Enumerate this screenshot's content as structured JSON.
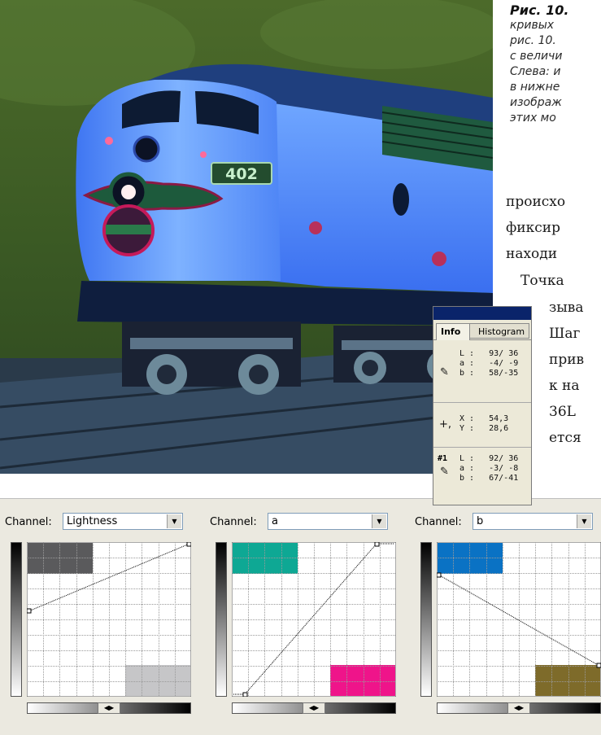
{
  "caption": {
    "title": "Рис. 10.",
    "lines": [
      "кривых",
      "рис. 10.",
      "с величи",
      "Слева: и",
      "в нижне",
      "изображ",
      "этих мо"
    ]
  },
  "body_text": {
    "lines": [
      "происхо",
      "фиксир",
      "находи",
      "Точка",
      "зыва",
      "Шаг",
      "прив",
      "к на",
      "36L",
      "ется"
    ]
  },
  "photo": {
    "number_plate": "402"
  },
  "info_panel": {
    "tabs": [
      "Info",
      "Histogram"
    ],
    "lab_readout": [
      "L :   93/ 36",
      "a :   -4/ -9",
      "b :   58/-35"
    ],
    "xy_readout": [
      "X :   54,3",
      "Y :   28,6"
    ],
    "sampler_label": "#1",
    "sampler_readout": [
      "L :   92/ 36",
      "a :   -3/ -8",
      "b :   67/-41"
    ]
  },
  "curves": [
    {
      "label": "Channel:",
      "value": "Lightness",
      "swatch_top": "#5a5a5c",
      "swatch_bottom": "#c6c6c8"
    },
    {
      "label": "Channel:",
      "value": "a",
      "swatch_top": "#0ea894",
      "swatch_bottom": "#ef148a"
    },
    {
      "label": "Channel:",
      "value": "b",
      "swatch_top": "#0a72c4",
      "swatch_bottom": "#7e6b2a"
    }
  ]
}
